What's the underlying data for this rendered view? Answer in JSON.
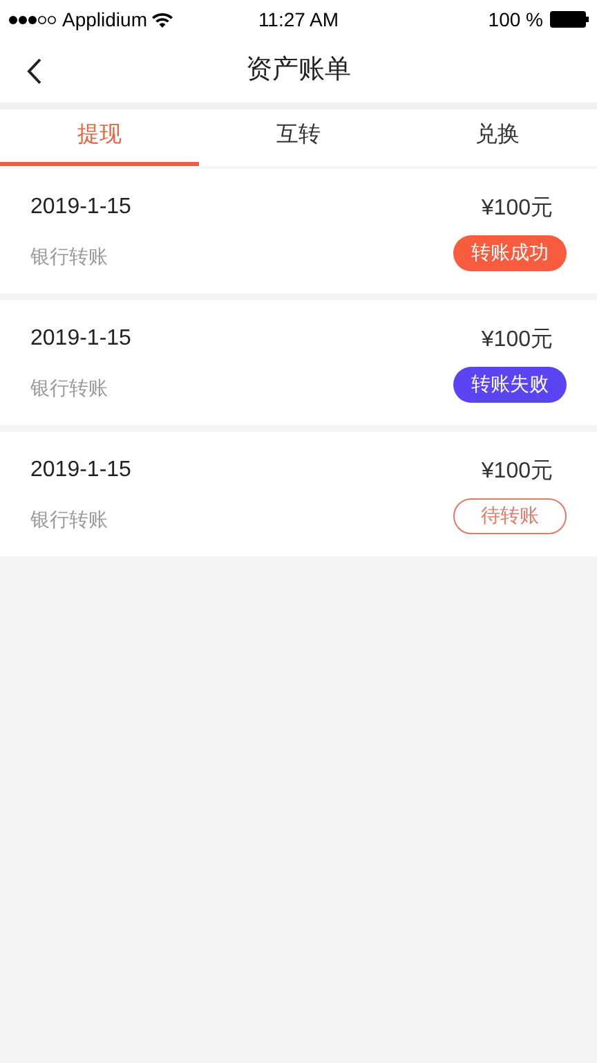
{
  "status_bar": {
    "carrier": "Applidium",
    "time": "11:27 AM",
    "battery": "100 %"
  },
  "nav": {
    "title": "资产账单"
  },
  "tabs": [
    {
      "label": "提现",
      "selected": true
    },
    {
      "label": "互转",
      "selected": false
    },
    {
      "label": "兑换",
      "selected": false
    }
  ],
  "records": [
    {
      "date": "2019-1-15",
      "amount": "¥100元",
      "method": "银行转账",
      "status": {
        "label": "转账成功",
        "kind": "filled",
        "color": "#f75c3f"
      }
    },
    {
      "date": "2019-1-15",
      "amount": "¥100元",
      "method": "银行转账",
      "status": {
        "label": "转账失败",
        "kind": "filled",
        "color": "#5b45f2"
      }
    },
    {
      "date": "2019-1-15",
      "amount": "¥100元",
      "method": "银行转账",
      "status": {
        "label": "待转账",
        "kind": "outline",
        "color": "#e07a6a"
      }
    }
  ]
}
